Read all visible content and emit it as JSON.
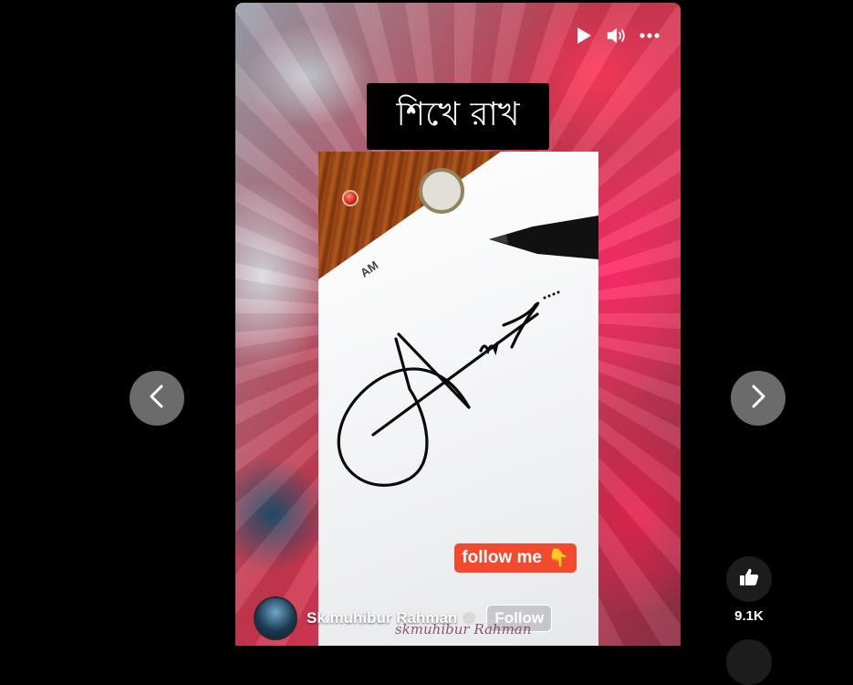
{
  "video": {
    "overlay_title": "শিখে রাখ",
    "paper_label": "AM",
    "follow_badge": {
      "text": "follow me",
      "emoji": "👇"
    },
    "watermark": "skmuhibur Rahman",
    "channel": {
      "name": "Sk.muhibur Rahman",
      "follow_label": "Follow"
    },
    "controls": {
      "icons": [
        "play-icon",
        "volume-icon",
        "more-icon"
      ]
    }
  },
  "navigation": {
    "prev_icon": "chevron-left-icon",
    "next_icon": "chevron-right-icon"
  },
  "actions": {
    "like_icon": "thumbs-up-icon",
    "like_count": "9.1K"
  },
  "colors": {
    "follow_badge_bg": "#f24a2f",
    "nav_button_bg": "#6b6b6b",
    "action_button_bg": "#1c1c1c"
  }
}
